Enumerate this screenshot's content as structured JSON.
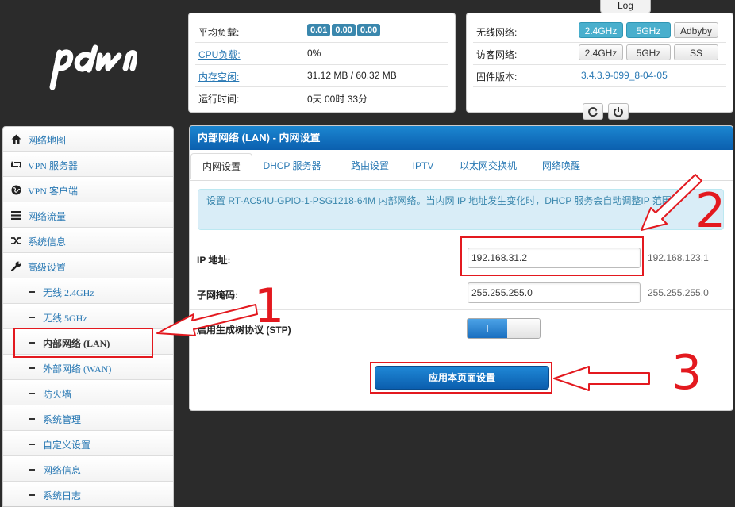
{
  "log_tab": "Log",
  "status": {
    "rows": [
      {
        "label": "平均负载:",
        "link": false,
        "badges": [
          "0.01",
          "0.00",
          "0.00"
        ]
      },
      {
        "label": "CPU负载:",
        "link": true,
        "value": "0%"
      },
      {
        "label": "内存空闲:",
        "link": true,
        "value": "31.12 MB / 60.32 MB"
      },
      {
        "label": "运行时间:",
        "link": false,
        "value": "0天 00时 33分"
      }
    ]
  },
  "network": {
    "wireless_label": "无线网络:",
    "wireless_buttons": [
      "2.4GHz",
      "5GHz",
      "Adbyby"
    ],
    "guest_label": "访客网络:",
    "guest_buttons": [
      "2.4GHz",
      "5GHz",
      "SS"
    ],
    "firmware_label": "固件版本:",
    "firmware_value": "3.4.3.9-099_8-04-05"
  },
  "sidebar": {
    "items": [
      {
        "label": "网络地图",
        "icon": "home-icon"
      },
      {
        "label": "VPN 服务器",
        "icon": "retweet-icon"
      },
      {
        "label": "VPN 客户端",
        "icon": "globe-icon"
      },
      {
        "label": "网络流量",
        "icon": "list-icon"
      },
      {
        "label": "系统信息",
        "icon": "shuffle-icon"
      },
      {
        "label": "高级设置",
        "icon": "wrench-icon"
      }
    ],
    "subitems": [
      {
        "label": "无线 2.4GHz",
        "current": false
      },
      {
        "label": "无线 5GHz",
        "current": false
      },
      {
        "label": "内部网络 (LAN)",
        "current": true
      },
      {
        "label": "外部网络 (WAN)",
        "current": false
      },
      {
        "label": "防火墙",
        "current": false
      },
      {
        "label": "系统管理",
        "current": false
      },
      {
        "label": "自定义设置",
        "current": false
      },
      {
        "label": "网络信息",
        "current": false
      },
      {
        "label": "系统日志",
        "current": false
      }
    ]
  },
  "main": {
    "title": "内部网络 (LAN) - 内网设置",
    "tabs": [
      "内网设置",
      "DHCP 服务器",
      "路由设置",
      "IPTV",
      "以太网交换机",
      "网络唤醒"
    ],
    "active_tab": 0,
    "info": "设置 RT-AC54U-GPIO-1-PSG1218-64M 内部网络。当内网 IP 地址发生变化时，DHCP 服务会自动调整IP 范围。",
    "ip_label": "IP 地址:",
    "ip_value": "192.168.31.2",
    "ip_default": "192.168.123.1",
    "mask_label": "子网掩码:",
    "mask_value": "255.255.255.0",
    "mask_default": "255.255.255.0",
    "stp_label": "启用生成树协议 (STP)",
    "stp_on_label": "I",
    "stp_enabled": true,
    "apply_label": "应用本页面设置"
  },
  "annotations": [
    "1",
    "2",
    "3"
  ],
  "colors": {
    "accent_blue": "#0b5fae",
    "link_blue": "#2a79b4",
    "annotation_red": "#e3191f",
    "background": "#2b2b2b"
  }
}
